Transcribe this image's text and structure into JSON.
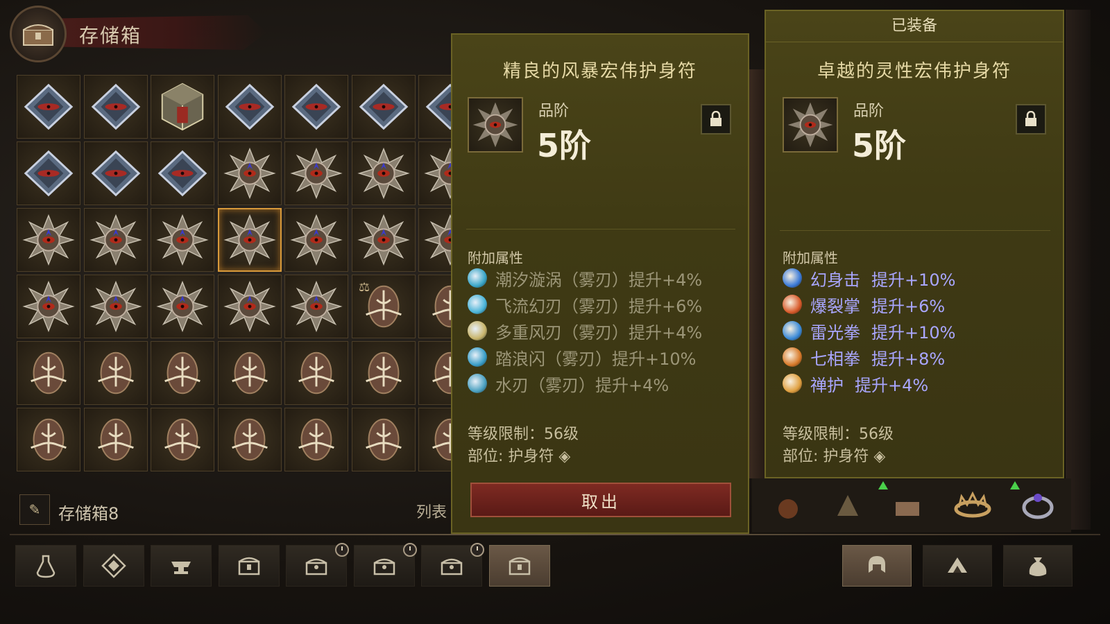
{
  "stash": {
    "title": "存储箱",
    "name": "存储箱8",
    "list_label": "列表"
  },
  "grid": {
    "rows": [
      [
        "diamond",
        "diamond",
        "cube",
        "diamond",
        "diamond",
        "diamond",
        "diamond"
      ],
      [
        "diamond",
        "diamond",
        "diamond",
        "charm",
        "charm",
        "charm",
        "charm"
      ],
      [
        "charm",
        "charm",
        "charm",
        "charm",
        "charm",
        "charm",
        "charm"
      ],
      [
        "charm",
        "charm",
        "charm",
        "charm",
        "charm",
        "rune",
        "rune"
      ],
      [
        "rune",
        "rune",
        "rune",
        "rune",
        "rune",
        "rune",
        "rune"
      ],
      [
        "rune",
        "rune",
        "rune",
        "rune",
        "rune",
        "rune",
        "rune"
      ]
    ],
    "selected": {
      "row": 2,
      "col": 3
    },
    "marked_icon": "scales-icon"
  },
  "tooltip_left": {
    "title": "精良的风暴宏伟护身符",
    "tier_label": "品阶",
    "tier_value": "5阶",
    "attr_header": "附加属性",
    "attributes": [
      {
        "text": "潮汐漩涡（雾刃）提升+4%",
        "icon_color": "#3aa6c8"
      },
      {
        "text": "飞流幻刃（雾刃）提升+6%",
        "icon_color": "#4ab4d8"
      },
      {
        "text": "多重风刃（雾刃）提升+4%",
        "icon_color": "#c8b46a"
      },
      {
        "text": "踏浪闪（雾刃）提升+10%",
        "icon_color": "#3a9ec8"
      },
      {
        "text": "水刃（雾刃）提升+4%",
        "icon_color": "#4aa0c0"
      }
    ],
    "level_req": "等级限制：56级",
    "slot": "部位: 护身符",
    "button": "取出"
  },
  "tooltip_right": {
    "header": "已装备",
    "title": "卓越的灵性宏伟护身符",
    "tier_label": "品阶",
    "tier_value": "5阶",
    "attr_header": "附加属性",
    "attributes": [
      {
        "name": "幻身击",
        "bonus": "提升+10%",
        "icon_color": "#3a7ad8"
      },
      {
        "name": "爆裂掌",
        "bonus": "提升+6%",
        "icon_color": "#d85a2a"
      },
      {
        "name": "雷光拳",
        "bonus": "提升+10%",
        "icon_color": "#3a8ad8"
      },
      {
        "name": "七相拳",
        "bonus": "提升+8%",
        "icon_color": "#d87a2a"
      },
      {
        "name": "禅护",
        "bonus": "提升+4%",
        "icon_color": "#e0a040"
      }
    ],
    "level_req": "等级限制：56级",
    "slot": "部位: 护身符"
  },
  "bottom_tabs": [
    {
      "icon": "potion-icon",
      "clock": false,
      "active": false
    },
    {
      "icon": "gem-icon",
      "clock": false,
      "active": false
    },
    {
      "icon": "anvil-icon",
      "clock": false,
      "active": false
    },
    {
      "icon": "chest-icon",
      "clock": false,
      "active": false
    },
    {
      "icon": "ornate-chest-icon",
      "clock": true,
      "active": false
    },
    {
      "icon": "ornate-chest-icon",
      "clock": true,
      "active": false
    },
    {
      "icon": "ornate-chest-icon",
      "clock": true,
      "active": false
    },
    {
      "icon": "chest-icon",
      "clock": false,
      "active": true
    }
  ],
  "right_tabs": [
    {
      "icon": "helmet-icon",
      "active": true
    },
    {
      "icon": "shard-icon",
      "active": false
    },
    {
      "icon": "bag-icon",
      "active": false
    }
  ],
  "colors": {
    "panel": "#4a4418",
    "selected_border": "#d99a3a",
    "bonus_text": "#a9a6ff",
    "take_button": "#7e2a22"
  }
}
